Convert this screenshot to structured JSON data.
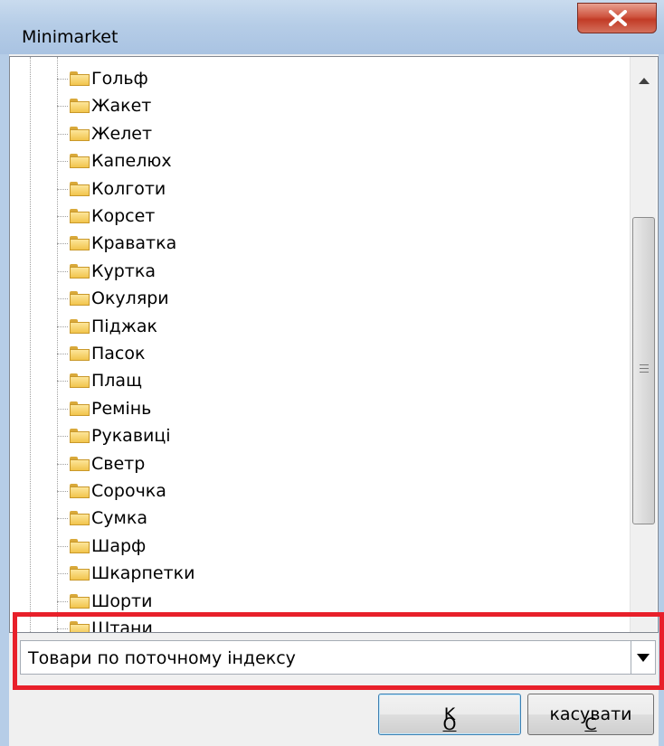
{
  "window": {
    "title": "Minimarket",
    "close_icon": "close-x-icon"
  },
  "tree": {
    "items": [
      {
        "label": "Гольф"
      },
      {
        "label": "Жакет"
      },
      {
        "label": "Желет"
      },
      {
        "label": "Капелюх"
      },
      {
        "label": "Колготи"
      },
      {
        "label": "Корсет"
      },
      {
        "label": "Краватка"
      },
      {
        "label": "Куртка"
      },
      {
        "label": "Окуляри"
      },
      {
        "label": "Піджак"
      },
      {
        "label": "Пасок"
      },
      {
        "label": "Плащ"
      },
      {
        "label": "Ремінь"
      },
      {
        "label": "Рукавиці"
      },
      {
        "label": "Светр"
      },
      {
        "label": "Сорочка"
      },
      {
        "label": "Сумка"
      },
      {
        "label": "Шарф"
      },
      {
        "label": "Шкарпетки"
      },
      {
        "label": "Шорти"
      },
      {
        "label": "Штани"
      }
    ],
    "item_icon": "folder-icon"
  },
  "combo": {
    "value": "Товари по поточному індексу",
    "icon": "dropdown-arrow-icon"
  },
  "buttons": {
    "ok_mnemonic": "O",
    "ok_rest": "K",
    "cancel_mnemonic": "С",
    "cancel_rest": "касувати"
  },
  "colors": {
    "highlight": "#e8202a",
    "titlebar": "#b6cde7",
    "close_button": "#c23b26",
    "folder": "#f2c44c"
  }
}
